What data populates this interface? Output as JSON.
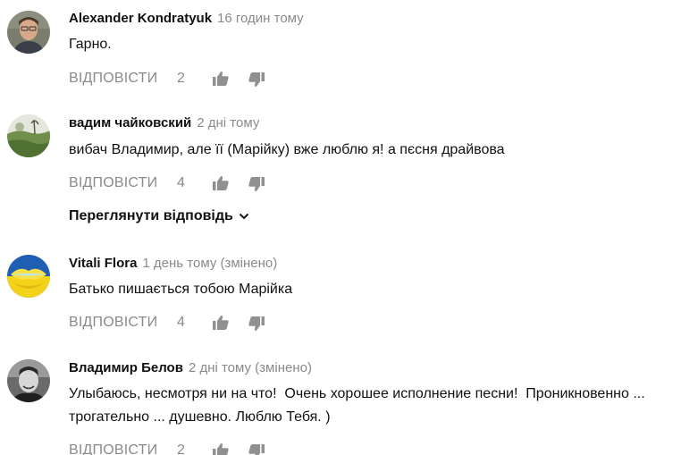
{
  "comments": [
    {
      "author": "Alexander Kondratyuk",
      "time": "16 годин тому",
      "text": "Гарно.",
      "reply_label": "ВІДПОВІСТИ",
      "likes": "2",
      "avatar_icon": "person-portrait-avatar"
    },
    {
      "author": "вадим чайковский",
      "time": "2 дні тому",
      "text": "вибач Владимир, але її (Марійку) вже люблю я! а пєсня драйвова",
      "reply_label": "ВІДПОВІСТИ",
      "likes": "4",
      "avatar_icon": "landscape-avatar"
    },
    {
      "author": "Vitali Flora",
      "time": "1 день тому (змінено)",
      "text": "Батько пишається тобою Марійка",
      "reply_label": "ВІДПОВІСТИ",
      "likes": "4",
      "avatar_icon": "flag-lips-avatar"
    },
    {
      "author": "Владимир Белов",
      "time": "2 дні тому (змінено)",
      "text_lines": [
        "Улыбаюсь, несмотря ни на что!  Очень хорошее исполнение песни!  Проникновенно ...",
        "трогательно ... душевно. Люблю Тебя. )"
      ],
      "reply_label": "ВІДПОВІСТИ",
      "likes": "2",
      "avatar_icon": "person-bw-avatar"
    }
  ],
  "view_replies": {
    "label": "Переглянути відповідь"
  },
  "colors": {
    "text": "#111111",
    "secondary": "#8a8a8a",
    "icon": "#909090"
  }
}
